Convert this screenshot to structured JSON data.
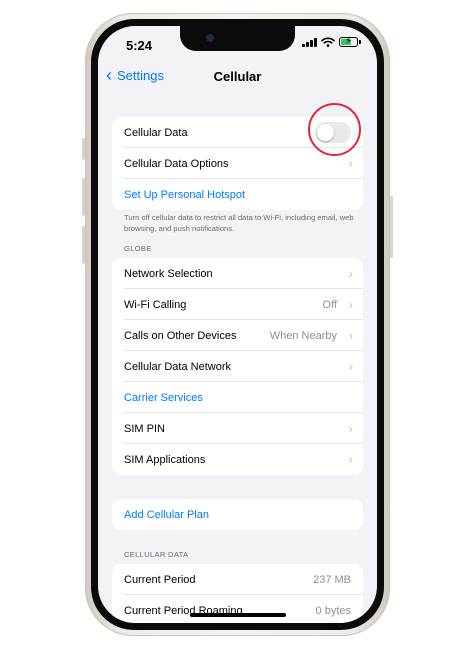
{
  "status_bar": {
    "time": "5:24"
  },
  "nav": {
    "back_label": "Settings",
    "title": "Cellular"
  },
  "group1": {
    "cellular_data_label": "Cellular Data",
    "cellular_data_on": false,
    "options_label": "Cellular Data Options",
    "hotspot_label": "Set Up Personal Hotspot"
  },
  "footnote": "Turn off cellular data to restrict all data to Wi-Fi, including email, web browsing, and push notifications.",
  "carrier_section": {
    "header": "GLOBE",
    "rows": {
      "network_selection": {
        "label": "Network Selection"
      },
      "wifi_calling": {
        "label": "Wi-Fi Calling",
        "value": "Off"
      },
      "calls_other_devices": {
        "label": "Calls on Other Devices",
        "value": "When Nearby"
      },
      "cellular_data_network": {
        "label": "Cellular Data Network"
      },
      "carrier_services": {
        "label": "Carrier Services"
      },
      "sim_pin": {
        "label": "SIM PIN"
      },
      "sim_applications": {
        "label": "SIM Applications"
      }
    }
  },
  "plan": {
    "add_label": "Add Cellular Plan"
  },
  "data_section": {
    "header": "CELLULAR DATA",
    "current_period": {
      "label": "Current Period",
      "value": "237 MB"
    },
    "current_period_roaming": {
      "label": "Current Period Roaming",
      "value": "0 bytes"
    }
  },
  "colors": {
    "accent": "#007aff",
    "highlight": "#e0283c",
    "battery": "#34c759"
  }
}
